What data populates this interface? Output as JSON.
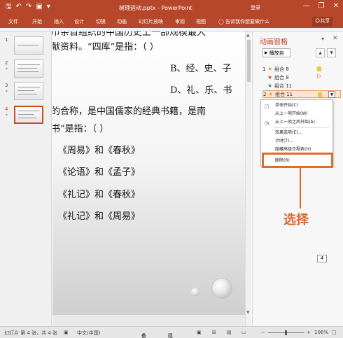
{
  "titlebar": {
    "qat": [
      "save-icon",
      "undo-icon",
      "redo-icon",
      "slideshow-icon",
      "qat-more-icon"
    ],
    "title": "树理运动.pptx - PowerPoint",
    "login": "登录",
    "min": "—",
    "restore": "❐",
    "close": "✕"
  },
  "ribbon": {
    "tabs": [
      "文件",
      "开始",
      "插入",
      "设计",
      "切换",
      "动画",
      "幻灯片放映",
      "审阅",
      "视图"
    ],
    "tellme": "告诉我你想要做什么",
    "share": "共享"
  },
  "thumbnails": [
    {
      "num": "1",
      "star": ""
    },
    {
      "num": "2",
      "star": "*"
    },
    {
      "num": "3",
      "star": "*"
    },
    {
      "num": "4",
      "star": "*",
      "selected": true
    }
  ],
  "slide": {
    "lines": [
      "市亲自组织的中国历史上一部规模最大",
      "献资料。“四库”是指：（    ）",
      "B、经、史、子",
      "D、礼、乐、书",
      "的合称，是中国儒家的经典书籍，是南",
      "书”是指：（    ）",
      "《周易》和《春秋》",
      "《论语》和《孟子》",
      "《礼记》和《春秋》",
      "《礼记》和《周易》"
    ]
  },
  "animation_pane": {
    "title": "动画窗格",
    "pin": "▾",
    "close": "✕",
    "play_label": "播放自",
    "up": "▲",
    "down": "▼",
    "items": [
      {
        "index": "1",
        "star_color": "#e8a33b",
        "label": "组合 8",
        "marker": "#f5c23d"
      },
      {
        "index": "",
        "star_color": "#d6443c",
        "label": "组合 8",
        "marker": "#d6443c"
      },
      {
        "index": "",
        "star_color": "#3a8f5a",
        "label": "组合 11",
        "marker": ""
      },
      {
        "index": "2",
        "star_color": "#e8a33b",
        "label": "组合 11",
        "marker": "#f5c23d",
        "selected": true
      }
    ]
  },
  "context_menu": {
    "items": [
      {
        "icon": "click-icon",
        "label": "单击开始(C)"
      },
      {
        "icon": "",
        "label": "从上一项开始(W)"
      },
      {
        "icon": "clock-icon",
        "label": "从上一项之后开始(A)"
      },
      {
        "icon": "",
        "label": "效果选项(E)..."
      },
      {
        "icon": "",
        "label": "计时(T)..."
      },
      {
        "icon": "",
        "label": "隐藏高级日程表(H)"
      },
      {
        "icon": "",
        "label": "删除(R)"
      }
    ]
  },
  "annotation": {
    "label": "选择",
    "color": "#e06c2c"
  },
  "statusbar": {
    "slide_info": "幻灯片 第 4 张，共 4 张",
    "language": "中文(中国)",
    "notes": "备注",
    "comments": "批注",
    "zoom": "106%",
    "page_box": "4"
  }
}
